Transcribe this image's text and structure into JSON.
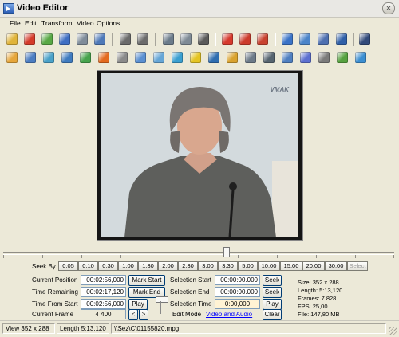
{
  "window": {
    "title": "Video Editor"
  },
  "menu": [
    "File",
    "Edit",
    "Transform",
    "Video",
    "Options"
  ],
  "toolbar1": [
    {
      "icon": "open-folder-icon",
      "color": "#e0b43a"
    },
    {
      "icon": "close-file-icon",
      "color": "#d43b2a"
    },
    {
      "icon": "new-file-icon",
      "color": "#58a845"
    },
    {
      "icon": "save-icon",
      "color": "#3f6fc3"
    },
    {
      "icon": "grid-icon",
      "color": "#7f8c9a"
    },
    {
      "icon": "properties-icon",
      "color": "#4e79b8"
    },
    {
      "icon": "undo-icon",
      "color": "#6b6b6b"
    },
    {
      "icon": "redo-icon",
      "color": "#6b6b6b"
    },
    {
      "icon": "crop-icon",
      "color": "#6b7b8a"
    },
    {
      "icon": "copy-icon",
      "color": "#7e8a95"
    },
    {
      "icon": "cut-icon",
      "color": "#5a5a5a"
    },
    {
      "icon": "split-icon",
      "color": "#d63a2e"
    },
    {
      "icon": "join-icon",
      "color": "#cc3b2c"
    },
    {
      "icon": "insert-icon",
      "color": "#c8422f"
    },
    {
      "icon": "export-icon",
      "color": "#3a73c7"
    },
    {
      "icon": "compare-icon",
      "color": "#4b84c9"
    },
    {
      "icon": "layers-icon",
      "color": "#4d6fb0"
    },
    {
      "icon": "text-icon",
      "color": "#2f5fa8"
    },
    {
      "icon": "zoom-icon",
      "color": "#324a7a"
    }
  ],
  "toolbar2": [
    {
      "icon": "adjust-icon",
      "color": "#e6a63a"
    },
    {
      "icon": "levels-icon",
      "color": "#4b7dc1"
    },
    {
      "icon": "brightness-icon",
      "color": "#4aa1c8"
    },
    {
      "icon": "contrast-icon",
      "color": "#3f7bbf"
    },
    {
      "icon": "color-balance-icon",
      "color": "#46a34d"
    },
    {
      "icon": "fire-icon",
      "color": "#e36a1f"
    },
    {
      "icon": "face-icon",
      "color": "#8a8a8a"
    },
    {
      "icon": "frame-icon",
      "color": "#5a8fd1"
    },
    {
      "icon": "channels-icon",
      "color": "#66a6d6"
    },
    {
      "icon": "sharpen-icon",
      "color": "#3a9fd0"
    },
    {
      "icon": "lightning-icon",
      "color": "#e4c423"
    },
    {
      "icon": "mosaic-icon",
      "color": "#2f6db0"
    },
    {
      "icon": "picture-icon",
      "color": "#d9a22e"
    },
    {
      "icon": "grain-icon",
      "color": "#6c7a88"
    },
    {
      "icon": "emboss-icon",
      "color": "#56646f"
    },
    {
      "icon": "stretch-icon",
      "color": "#4f7fc0"
    },
    {
      "icon": "noise-icon",
      "color": "#5c6fd0"
    },
    {
      "icon": "rotate-icon",
      "color": "#7a7a7a"
    },
    {
      "icon": "wave-icon",
      "color": "#56a13f"
    },
    {
      "icon": "landscape-icon",
      "color": "#3b8ed1"
    }
  ],
  "preview": {
    "watermark": "VMAK"
  },
  "timeline": {
    "position": 0.57
  },
  "seek": {
    "label": "Seek By",
    "intervals": [
      "0:05",
      "0:10",
      "0:30",
      "1:00",
      "1:30",
      "2:00",
      "2:30",
      "3:00",
      "3:30",
      "5:00",
      "10:00",
      "15:00",
      "20:00",
      "30:00",
      "Select"
    ]
  },
  "controls": {
    "current_position_label": "Current Position",
    "current_position": "00:02:56,000",
    "mark_start": "Mark Start",
    "time_remaining_label": "Time Remaining",
    "time_remaining": "00:02:17,120",
    "mark_end": "Mark End",
    "time_from_start_label": "Time From Start",
    "time_from_start": "00:02:56,000",
    "play1": "Play",
    "current_frame_label": "Current Frame",
    "current_frame": "4 400",
    "prev": "<",
    "next": ">",
    "selection_start_label": "Selection Start",
    "selection_start": "00:00:00.000",
    "seek1": "Seek",
    "selection_end_label": "Selection End",
    "selection_end": "00:00:00.000",
    "seek2": "Seek",
    "selection_time_label": "Selection Time",
    "selection_time": "0:00,000",
    "play2": "Play",
    "edit_mode_label": "Edit Mode",
    "edit_mode": "Video and Audio",
    "clear": "Clear"
  },
  "info": {
    "size": "Size:  352 x 288",
    "length": "Length:  5:13,120",
    "frames": "Frames:  7 828",
    "fps": "FPS:  25,00",
    "file": "File:  147,80 MB"
  },
  "status": {
    "view": "View 352 x 288",
    "length": "Length 5:13,120",
    "path": "\\\\Sez\\C\\01155820.mpg"
  }
}
